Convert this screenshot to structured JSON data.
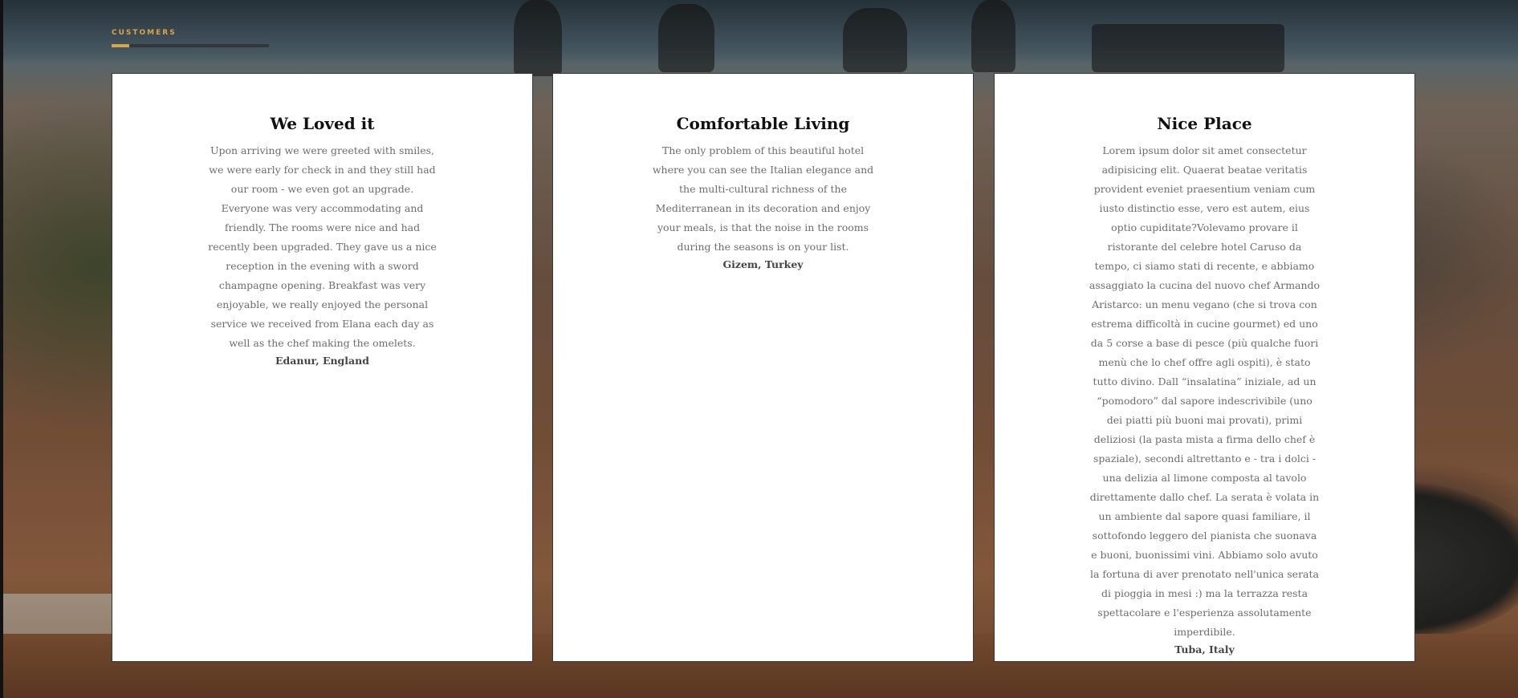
{
  "section": {
    "label": "CUSTOMERS"
  },
  "colors": {
    "accent": "#d8a548",
    "card_background": "#ffffff",
    "title_text": "#111111",
    "body_text": "#6d6d6d"
  },
  "testimonials": [
    {
      "title": "We Loved it",
      "text": "Upon arriving we were greeted with smiles, we were early for check in and they still had our room - we even got an upgrade. Everyone was very accommodating and friendly. The rooms were nice and had recently been upgraded. They gave us a nice reception in the evening with a sword champagne opening. Breakfast was very enjoyable, we really enjoyed the personal service we received from Elana each day as well as the chef making the omelets.",
      "author": "Edanur, England"
    },
    {
      "title": "Comfortable Living",
      "text": "The only problem of this beautiful hotel where you can see the Italian elegance and the multi-cultural richness of the Mediterranean in its decoration and enjoy your meals, is that the noise in the rooms during the seasons is on your list.",
      "author": "Gizem, Turkey"
    },
    {
      "title": "Nice Place",
      "text": "Lorem ipsum dolor sit amet consectetur adipisicing elit. Quaerat beatae veritatis provident eveniet praesentium veniam cum iusto distinctio esse, vero est autem, eius optio cupiditate?Volevamo provare il ristorante del celebre hotel Caruso da tempo, ci siamo stati di recente, e abbiamo assaggiato la cucina del nuovo chef Armando Aristarco: un menu vegano (che si trova con estrema difficoltà in cucine gourmet) ed uno da 5 corse a base di pesce (più qualche fuori menù che lo chef offre agli ospiti), è stato tutto divino. Dall “insalatina” iniziale, ad un “pomodoro” dal sapore indescrivibile (uno dei piatti più buoni mai provati), primi deliziosi (la pasta mista a firma dello chef è spaziale), secondi altrettanto e - tra i dolci - una delizia al limone composta al tavolo direttamente dallo chef. La serata è volata in un ambiente dal sapore quasi familiare, il sottofondo leggero del pianista che suonava e buoni, buonissimi vini. Abbiamo solo avuto la fortuna di aver prenotato nell'unica serata di pioggia in mesi :) ma la terrazza resta spettacolare e l'esperienza assolutamente imperdibile.",
      "author": "Tuba, Italy"
    }
  ]
}
